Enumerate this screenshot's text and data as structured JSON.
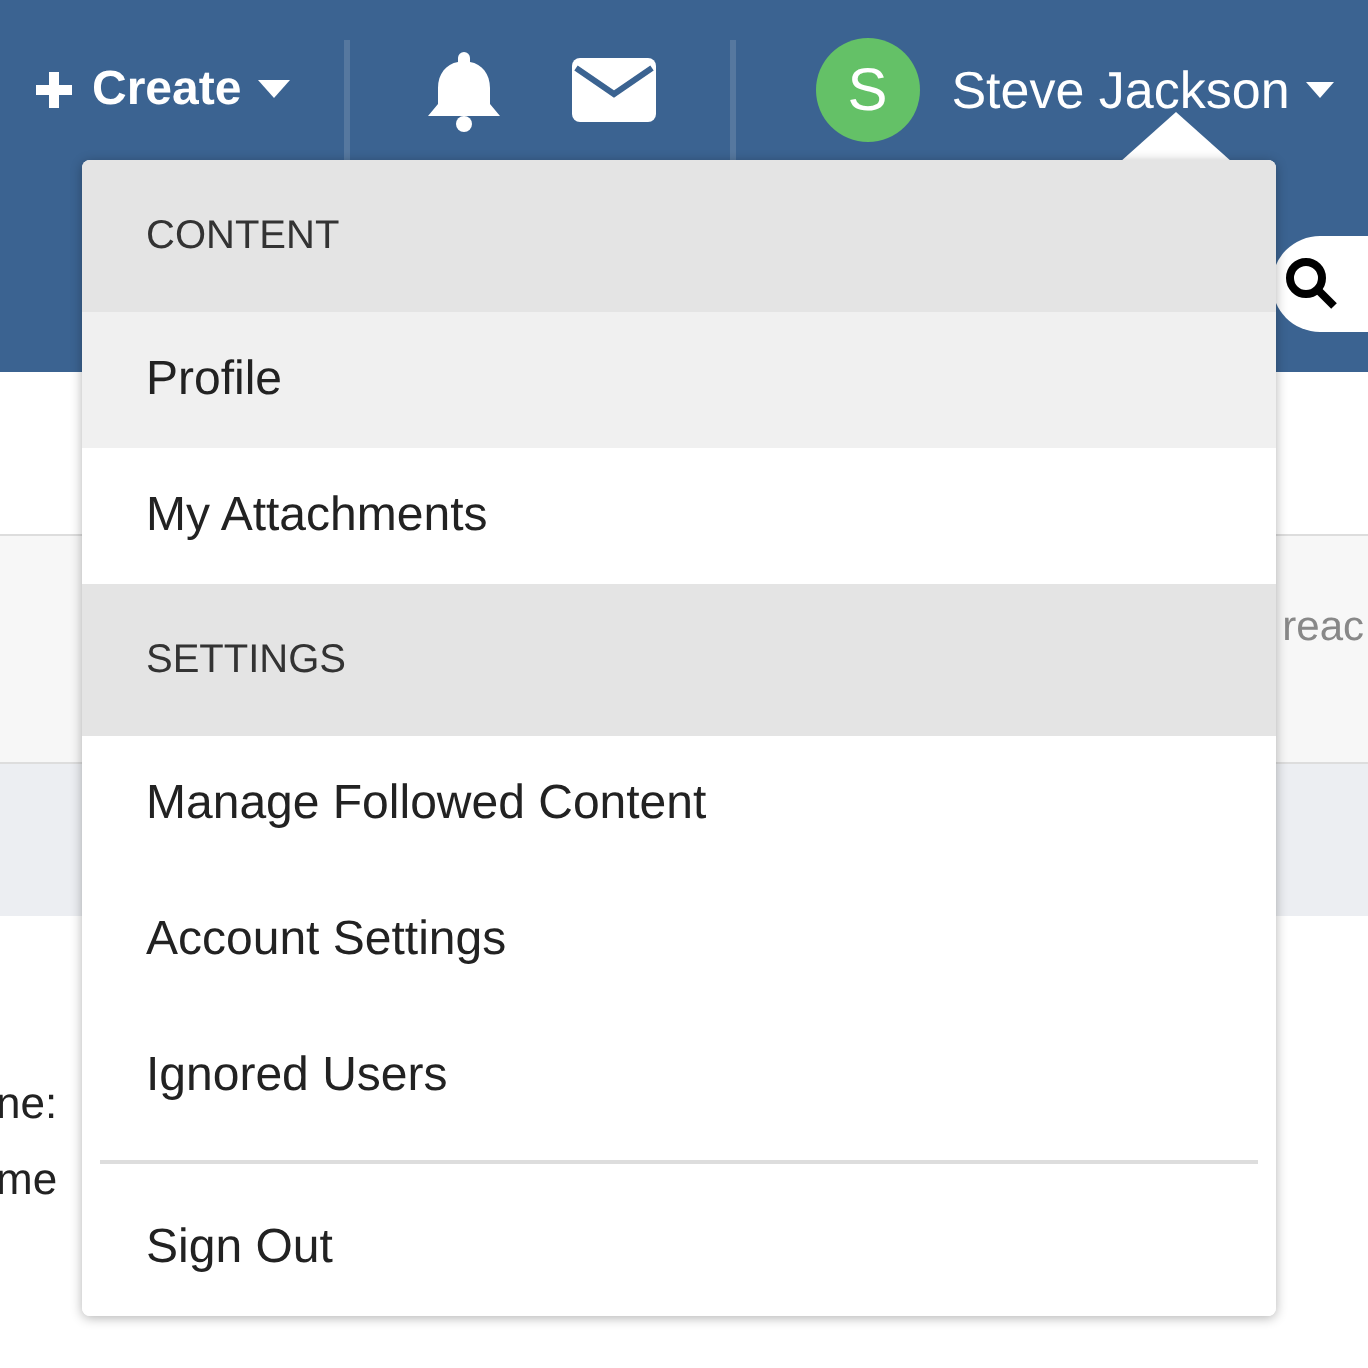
{
  "top_bar": {
    "create_button": {
      "label": "Create"
    },
    "user": {
      "initial": "S",
      "name": "Steve Jackson"
    }
  },
  "page": {
    "right_fragment": "reac",
    "left_fragments": [
      "ne:",
      "me"
    ]
  },
  "user_menu": {
    "items": [
      {
        "kind": "header",
        "label": "CONTENT"
      },
      {
        "kind": "item",
        "label": "Profile",
        "selected": true
      },
      {
        "kind": "item",
        "label": "My Attachments",
        "selected": false
      },
      {
        "kind": "header",
        "label": "SETTINGS"
      },
      {
        "kind": "item",
        "label": "Manage Followed Content",
        "selected": false
      },
      {
        "kind": "item",
        "label": "Account Settings",
        "selected": false
      },
      {
        "kind": "item",
        "label": "Ignored Users",
        "selected": false
      },
      {
        "kind": "divider"
      },
      {
        "kind": "item",
        "label": "Sign Out",
        "selected": false
      }
    ]
  }
}
